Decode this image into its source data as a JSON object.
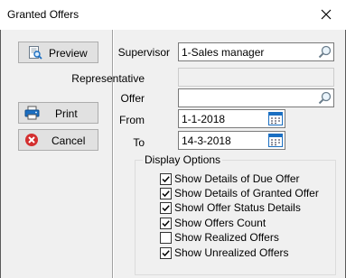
{
  "window": {
    "title": "Granted Offers"
  },
  "buttons": {
    "preview": "Preview",
    "print": "Print",
    "cancel": "Cancel"
  },
  "form": {
    "supervisor_label": "Supervisor",
    "supervisor_value": "1-Sales manager",
    "representative_label": "Representative",
    "representative_value": "",
    "offer_label": "Offer",
    "offer_value": "",
    "from_label": "From",
    "from_value": "1-1-2018",
    "to_label": "To",
    "to_value": "14-3-2018"
  },
  "display_options": {
    "title": "Display Options",
    "items": [
      {
        "label": "Show Details of Due Offer",
        "checked": true
      },
      {
        "label": "Show Details of Granted Offer",
        "checked": true
      },
      {
        "label": "Showl Offer Status Details",
        "checked": true
      },
      {
        "label": "Show Offers Count",
        "checked": true
      },
      {
        "label": "Show Realized Offers",
        "checked": false
      },
      {
        "label": "Show Unrealized Offers",
        "checked": true
      }
    ]
  },
  "colors": {
    "accent": "#1b6fc2",
    "cancel_icon": "#d32f2f"
  }
}
